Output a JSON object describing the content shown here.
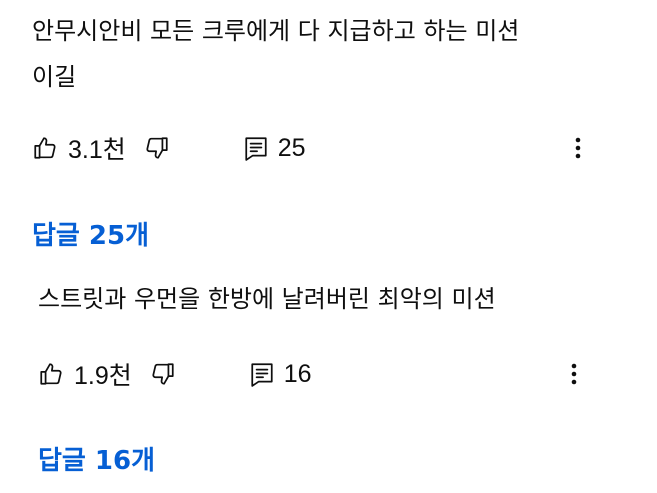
{
  "comments": [
    {
      "text": "안무시안비 모든 크루에게 다 지급하고 하는 미션\n이길",
      "likes": "3.1천",
      "replies_count": "25",
      "replies_label": "답글 25개"
    },
    {
      "text": "스트릿과 우먼을 한방에 날려버린 최악의 미션",
      "likes": "1.9천",
      "replies_count": "16",
      "replies_label": "답글 16개"
    }
  ],
  "icons": {
    "like": "thumbs-up-icon",
    "dislike": "thumbs-down-icon",
    "reply": "comment-icon",
    "more": "more-vertical-icon"
  },
  "colors": {
    "link": "#065fd4",
    "text": "#0f0f0f"
  }
}
